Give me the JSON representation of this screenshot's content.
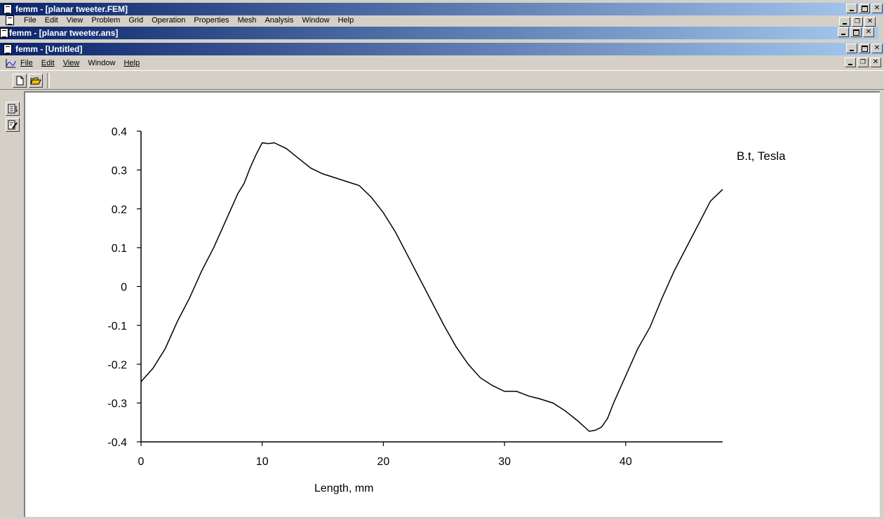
{
  "windows": {
    "fem": {
      "title": "femm - [planar tweeter.FEM]",
      "menu": [
        "File",
        "Edit",
        "View",
        "Problem",
        "Grid",
        "Operation",
        "Properties",
        "Mesh",
        "Analysis",
        "Window",
        "Help"
      ]
    },
    "ans": {
      "title": "femm - [planar tweeter.ans]"
    },
    "untitled": {
      "title": "femm - [Untitled]",
      "menu": [
        "File",
        "Edit",
        "View",
        "Window",
        "Help"
      ]
    }
  },
  "toolbar": {
    "buttons": [
      "new-document-icon",
      "open-folder-icon"
    ]
  },
  "sidebar": {
    "buttons": [
      "plot-settings-icon",
      "edit-data-icon"
    ]
  },
  "colors": {
    "titlebar_start": "#0a246a",
    "titlebar_end": "#a6caf0",
    "face": "#d4d0c8"
  },
  "chart_data": {
    "type": "line",
    "title": "",
    "legend": "B.t, Tesla",
    "xlabel": "Length, mm",
    "ylabel": "",
    "xlim": [
      0,
      48
    ],
    "ylim": [
      -0.4,
      0.4
    ],
    "xticks": [
      "0",
      "10",
      "20",
      "30",
      "40"
    ],
    "yticks": [
      "0.4",
      "0.3",
      "0.2",
      "0.1",
      "0",
      "-0.1",
      "-0.2",
      "-0.3",
      "-0.4"
    ],
    "series": [
      {
        "name": "B.t, Tesla",
        "x": [
          0,
          1,
          2,
          3,
          4,
          5,
          6,
          7,
          8,
          8.5,
          9,
          9.5,
          10,
          10.5,
          11,
          12,
          13,
          14,
          15,
          16,
          17,
          18,
          19,
          20,
          21,
          22,
          23,
          24,
          25,
          26,
          27,
          28,
          29,
          30,
          31,
          32,
          33,
          34,
          35,
          36,
          37,
          37.5,
          38,
          38.5,
          39,
          40,
          41,
          42,
          43,
          44,
          45,
          46,
          47,
          48
        ],
        "y": [
          -0.245,
          -0.21,
          -0.16,
          -0.09,
          -0.03,
          0.04,
          0.1,
          0.17,
          0.24,
          0.265,
          0.305,
          0.34,
          0.37,
          0.368,
          0.37,
          0.355,
          0.33,
          0.305,
          0.29,
          0.28,
          0.27,
          0.26,
          0.23,
          0.19,
          0.14,
          0.08,
          0.02,
          -0.04,
          -0.1,
          -0.155,
          -0.2,
          -0.235,
          -0.255,
          -0.27,
          -0.27,
          -0.282,
          -0.29,
          -0.3,
          -0.32,
          -0.345,
          -0.373,
          -0.37,
          -0.362,
          -0.34,
          -0.3,
          -0.23,
          -0.16,
          -0.105,
          -0.03,
          0.04,
          0.1,
          0.16,
          0.22,
          0.25
        ]
      }
    ]
  }
}
